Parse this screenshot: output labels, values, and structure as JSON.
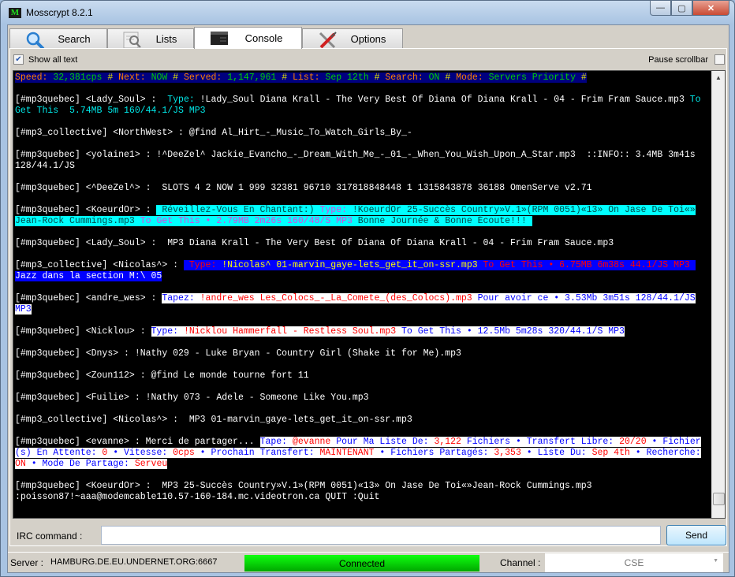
{
  "window": {
    "title": "Mosscrypt 8.2.1",
    "logo": "M",
    "minimize": "—",
    "maximize": "▢",
    "close": "✕"
  },
  "tabs": [
    {
      "label": "Search",
      "icon": "magnifier-icon"
    },
    {
      "label": "Lists",
      "icon": "document-search-icon"
    },
    {
      "label": "Console",
      "icon": "console-icon",
      "active": true
    },
    {
      "label": "Options",
      "icon": "tools-icon"
    }
  ],
  "toolbar": {
    "show_all_text": "Show all text",
    "show_all_checked": true,
    "pause_scrollbar": "Pause scrollbar",
    "pause_checked": false
  },
  "colors": {
    "status_bg": "#00007f",
    "label": "#ff8000",
    "value": "#00d000",
    "hash": "#e0e000",
    "cyan": "#00ffff",
    "white": "#ffffff",
    "dark": "#004848",
    "magenta": "#e040e0",
    "blue": "#0000ff",
    "red": "#ff0000",
    "yellow": "#ffff00",
    "connected": "#00e000"
  },
  "console": {
    "messages": [
      {
        "rows": [
          [
            {
              "t": "Speed: ",
              "c": "#ff8000",
              "bg": "#00007f"
            },
            {
              "t": "32,381cps ",
              "c": "#00d000",
              "bg": "#00007f"
            },
            {
              "t": "# ",
              "c": "#e0e000",
              "bg": "#00007f"
            },
            {
              "t": "Next: ",
              "c": "#ff8000",
              "bg": "#00007f"
            },
            {
              "t": "NOW ",
              "c": "#00d000",
              "bg": "#00007f"
            },
            {
              "t": "# ",
              "c": "#e0e000",
              "bg": "#00007f"
            },
            {
              "t": "Served: ",
              "c": "#ff8000",
              "bg": "#00007f"
            },
            {
              "t": "1,147,961 ",
              "c": "#00d000",
              "bg": "#00007f"
            },
            {
              "t": "# ",
              "c": "#e0e000",
              "bg": "#00007f"
            },
            {
              "t": "List: ",
              "c": "#ff8000",
              "bg": "#00007f"
            },
            {
              "t": "Sep 12th ",
              "c": "#00d000",
              "bg": "#00007f"
            },
            {
              "t": "# ",
              "c": "#e0e000",
              "bg": "#00007f"
            },
            {
              "t": "Search: ",
              "c": "#ff8000",
              "bg": "#00007f"
            },
            {
              "t": "ON ",
              "c": "#00d000",
              "bg": "#00007f"
            },
            {
              "t": "# ",
              "c": "#e0e000",
              "bg": "#00007f"
            },
            {
              "t": "Mode: ",
              "c": "#ff8000",
              "bg": "#00007f"
            },
            {
              "t": "Servers Priority ",
              "c": "#00d000",
              "bg": "#00007f"
            },
            {
              "t": "#",
              "c": "#e0e000",
              "bg": "#00007f"
            }
          ]
        ]
      },
      {
        "rows": [
          [
            {
              "t": "[#mp3quebec] <Lady_Soul> :  "
            },
            {
              "t": "Type: ",
              "c": "#00e8e8"
            },
            {
              "t": "!Lady_Soul Diana Krall - The Very Best Of Diana Of Diana Krall - 04 - Frim Fram Sauce.mp3 "
            },
            {
              "t": "To",
              "c": "#00e8e8"
            }
          ],
          [
            {
              "t": "Get This  5.74MB 5m 160/44.1/JS MP3",
              "c": "#00e8e8"
            }
          ]
        ]
      },
      {
        "rows": [
          [
            {
              "t": "[#mp3_collective] <NorthWest> : @find Al_Hirt_-_Music_To_Watch_Girls_By_-"
            }
          ]
        ]
      },
      {
        "rows": [
          [
            {
              "t": "[#mp3quebec] <yolaine1> : !^DeeZel^ Jackie_Evancho_-_Dream_With_Me_-_01_-_When_You_Wish_Upon_A_Star.mp3  ::INFO:: 3.4MB 3m41s"
            }
          ],
          [
            {
              "t": "128/44.1/JS"
            }
          ]
        ]
      },
      {
        "rows": [
          [
            {
              "t": "[#mp3quebec] <^DeeZel^> :  SLOTS 4 2 NOW 1 999 32381 96710 317818848448 1 1315843878 36188 OmenServe v2.71"
            }
          ]
        ]
      },
      {
        "rows": [
          [
            {
              "t": "[#mp3quebec] <KoeurdOr> : "
            },
            {
              "t": " Réveillez-Vous En Chantant:) ",
              "c": "#004848",
              "bg": "#00ffff"
            },
            {
              "t": "Type: ",
              "c": "#e040e0",
              "bg": "#00ffff"
            },
            {
              "t": "!KoeurdOr 25-Succès Country»V.1»(RPM 0051)«13» On Jase De Toi«»",
              "c": "#004848",
              "bg": "#00ffff"
            }
          ],
          [
            {
              "t": "Jean-Rock Cummings.mp3 ",
              "c": "#004848",
              "bg": "#00ffff"
            },
            {
              "t": "To Get This • 2.79MB 2m26s 160/48/S MP3",
              "c": "#e040e0",
              "bg": "#00ffff"
            },
            {
              "t": " Bonne Journée & Bonne Écoute!!! ",
              "c": "#004848",
              "bg": "#00ffff"
            }
          ]
        ]
      },
      {
        "rows": [
          [
            {
              "t": "[#mp3quebec] <Lady_Soul> :  MP3 Diana Krall - The Very Best Of Diana Of Diana Krall - 04 - Frim Fram Sauce.mp3"
            }
          ]
        ]
      },
      {
        "rows": [
          [
            {
              "t": "[#mp3_collective] <Nicolas^> : "
            },
            {
              "t": " ",
              "bg": "#0000ff"
            },
            {
              "t": "Type: ",
              "c": "#ff0000",
              "bg": "#0000ff"
            },
            {
              "t": "!Nicolas^ 01-marvin_gaye-lets_get_it_on-ssr.mp3 ",
              "c": "#ffff00",
              "bg": "#0000ff"
            },
            {
              "t": "To Get This • 6.75MB 6m38s 44.1/JS MP3 ",
              "c": "#ff0000",
              "bg": "#0000ff"
            }
          ],
          [
            {
              "t": "Jazz dans la section M:\\ 05",
              "c": "#ffffff",
              "bg": "#0000ff"
            }
          ]
        ]
      },
      {
        "rows": [
          [
            {
              "t": "[#mp3quebec] <andre_wes> : "
            },
            {
              "t": "Tapez: ",
              "c": "#0000ff",
              "bg": "#ffffff"
            },
            {
              "t": "!andre_wes Les_Colocs_-_La_Comete_(des_Colocs).mp3 ",
              "c": "#ff0000",
              "bg": "#ffffff"
            },
            {
              "t": "Pour avoir ce • 3.53Mb 3m51s 128/44.1/JS",
              "c": "#0000ff",
              "bg": "#ffffff"
            }
          ],
          [
            {
              "t": "MP3",
              "c": "#0000ff",
              "bg": "#ffffff"
            }
          ]
        ]
      },
      {
        "rows": [
          [
            {
              "t": "[#mp3quebec] <Nicklou> : "
            },
            {
              "t": "Type: ",
              "c": "#0000ff",
              "bg": "#ffffff"
            },
            {
              "t": "!Nicklou Hammerfall - Restless Soul.mp3 ",
              "c": "#ff0000",
              "bg": "#ffffff"
            },
            {
              "t": "To Get This • 12.5Mb 5m28s 320/44.1/S MP3",
              "c": "#0000ff",
              "bg": "#ffffff"
            }
          ]
        ]
      },
      {
        "rows": [
          [
            {
              "t": "[#mp3quebec] <Dnys> : !Nathy 029 - Luke Bryan - Country Girl (Shake it for Me).mp3"
            }
          ]
        ]
      },
      {
        "rows": [
          [
            {
              "t": "[#mp3quebec] <Zoun112> : @find Le monde tourne fort 11"
            }
          ]
        ]
      },
      {
        "rows": [
          [
            {
              "t": "[#mp3quebec] <Fuilie> : !Nathy 073 - Adele - Someone Like You.mp3"
            }
          ]
        ]
      },
      {
        "rows": [
          [
            {
              "t": "[#mp3_collective] <Nicolas^> :  MP3 01-marvin_gaye-lets_get_it_on-ssr.mp3"
            }
          ]
        ]
      },
      {
        "rows": [
          [
            {
              "t": "[#mp3quebec] <evanne> : Merci de partager... "
            },
            {
              "t": "Tape: ",
              "c": "#0000ff",
              "bg": "#ffffff"
            },
            {
              "t": "@evanne ",
              "c": "#ff0000",
              "bg": "#ffffff"
            },
            {
              "t": "Pour Ma Liste De: ",
              "c": "#0000ff",
              "bg": "#ffffff"
            },
            {
              "t": "3,122",
              "c": "#ff0000",
              "bg": "#ffffff"
            },
            {
              "t": " Fichiers • Transfert Libre: ",
              "c": "#0000ff",
              "bg": "#ffffff"
            },
            {
              "t": "20/20",
              "c": "#ff0000",
              "bg": "#ffffff"
            },
            {
              "t": " • Fichier",
              "c": "#0000ff",
              "bg": "#ffffff"
            }
          ],
          [
            {
              "t": "(s) En Attente: ",
              "c": "#0000ff",
              "bg": "#ffffff"
            },
            {
              "t": "0",
              "c": "#ff0000",
              "bg": "#ffffff"
            },
            {
              "t": " • Vitesse: ",
              "c": "#0000ff",
              "bg": "#ffffff"
            },
            {
              "t": "0cps",
              "c": "#ff0000",
              "bg": "#ffffff"
            },
            {
              "t": " • Prochain Transfert: ",
              "c": "#0000ff",
              "bg": "#ffffff"
            },
            {
              "t": "MAINTENANT",
              "c": "#ff0000",
              "bg": "#ffffff"
            },
            {
              "t": " • Fichiers Partagés: ",
              "c": "#0000ff",
              "bg": "#ffffff"
            },
            {
              "t": "3,353",
              "c": "#ff0000",
              "bg": "#ffffff"
            },
            {
              "t": " • Liste Du: ",
              "c": "#0000ff",
              "bg": "#ffffff"
            },
            {
              "t": "Sep 4th",
              "c": "#ff0000",
              "bg": "#ffffff"
            },
            {
              "t": " • Recherche:",
              "c": "#0000ff",
              "bg": "#ffffff"
            }
          ],
          [
            {
              "t": "ON",
              "c": "#ff0000",
              "bg": "#ffffff"
            },
            {
              "t": " • Mode De Partage: ",
              "c": "#0000ff",
              "bg": "#ffffff"
            },
            {
              "t": "Serveu",
              "c": "#ff0000",
              "bg": "#ffffff"
            }
          ]
        ]
      },
      {
        "rows": [
          [
            {
              "t": "[#mp3quebec] <KoeurdOr> :  MP3 25-Succès Country»V.1»(RPM 0051)«13» On Jase De Toi«»Jean-Rock Cummings.mp3"
            }
          ],
          [
            {
              "t": ":poisson87!~aaa@modemcable110.57-160-184.mc.videotron.ca QUIT :Quit"
            }
          ]
        ]
      }
    ]
  },
  "command": {
    "label": "IRC command :",
    "value": "",
    "send": "Send"
  },
  "statusbar": {
    "server_label": "Server :",
    "server": "HAMBURG.DE.EU.UNDERNET.ORG:6667",
    "connection": "Connected",
    "channel_label": "Channel :",
    "channel": "CSE",
    "dropdown_arrow": "▼"
  }
}
